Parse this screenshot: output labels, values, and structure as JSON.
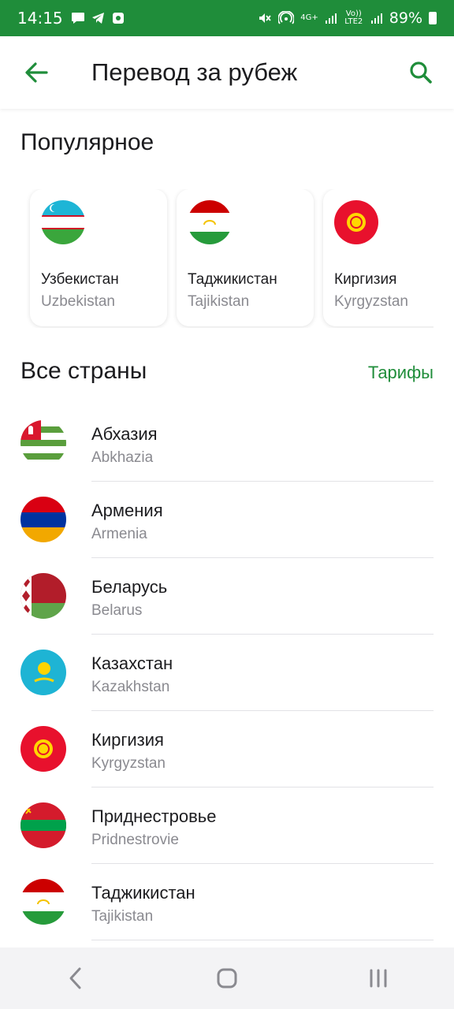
{
  "status_bar": {
    "time": "14:15",
    "network_small": "4G+",
    "lte_label": "Vo)) LTE2",
    "battery": "89%"
  },
  "header": {
    "title": "Перевод за рубеж"
  },
  "popular": {
    "heading": "Популярное",
    "items": [
      {
        "name": "Узбекистан",
        "latin": "Uzbekistan"
      },
      {
        "name": "Таджикистан",
        "latin": "Tajikistan"
      },
      {
        "name": "Киргизия",
        "latin": "Kyrgyzstan"
      }
    ]
  },
  "all_countries": {
    "heading": "Все страны",
    "tariffs_label": "Тарифы",
    "items": [
      {
        "name": "Абхазия",
        "latin": "Abkhazia"
      },
      {
        "name": "Армения",
        "latin": "Armenia"
      },
      {
        "name": "Беларусь",
        "latin": "Belarus"
      },
      {
        "name": "Казахстан",
        "latin": "Kazakhstan"
      },
      {
        "name": "Киргизия",
        "latin": "Kyrgyzstan"
      },
      {
        "name": "Приднестровье",
        "latin": "Pridnestrovie"
      },
      {
        "name": "Таджикистан",
        "latin": "Tajikistan"
      }
    ]
  },
  "colors": {
    "brand_green": "#1f8d3a",
    "secondary_text": "#8a8a90"
  }
}
